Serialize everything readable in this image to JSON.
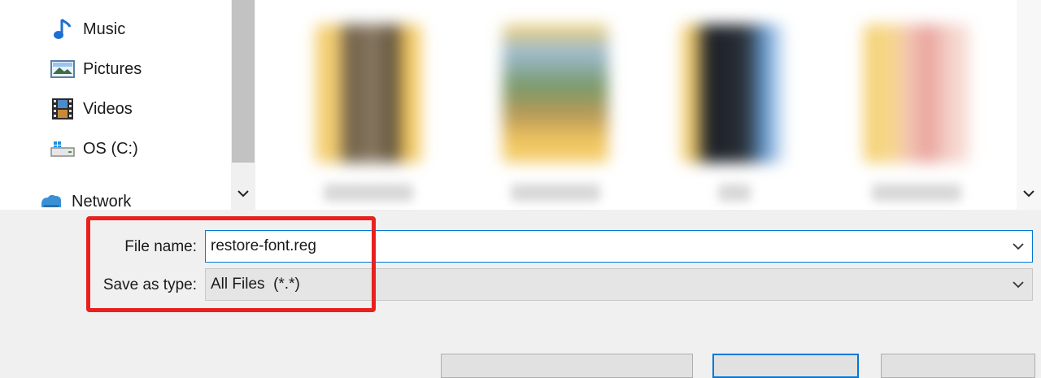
{
  "nav": {
    "items": [
      {
        "label": "Music",
        "icon": "music-note-icon"
      },
      {
        "label": "Pictures",
        "icon": "pictures-icon"
      },
      {
        "label": "Videos",
        "icon": "videos-icon"
      },
      {
        "label": "OS (C:)",
        "icon": "drive-icon"
      },
      {
        "label": "Network",
        "icon": "network-icon"
      }
    ]
  },
  "form": {
    "file_name_label": "File name:",
    "file_name_value": "restore-font.reg",
    "save_as_type_label": "Save as type:",
    "save_as_type_value": "All Files  (*.*)"
  },
  "colors": {
    "accent": "#0078d7",
    "highlight": "#e8211e"
  }
}
